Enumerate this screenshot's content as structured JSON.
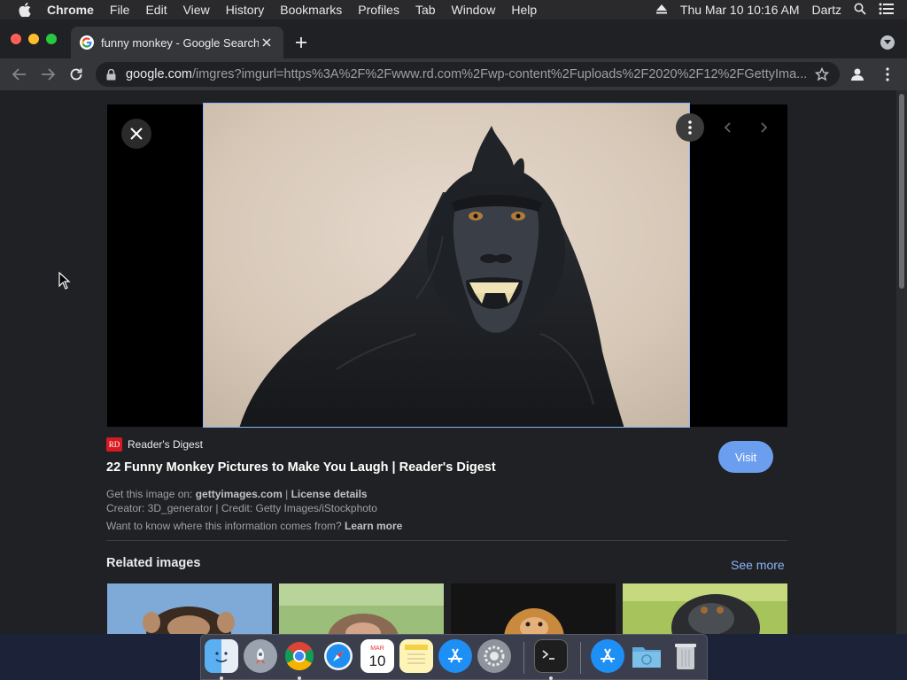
{
  "menubar": {
    "app": "Chrome",
    "items": [
      "File",
      "Edit",
      "View",
      "History",
      "Bookmarks",
      "Profiles",
      "Tab",
      "Window",
      "Help"
    ],
    "clock": "Thu Mar 10  10:16 AM",
    "user": "Dartz"
  },
  "browser": {
    "tab_title": "funny monkey - Google Search",
    "url_host": "google.com",
    "url_path": "/imgres?imgurl=https%3A%2F%2Fwww.rd.com%2Fwp-content%2Fuploads%2F2020%2F12%2FGettyIma..."
  },
  "result": {
    "source_logo": "RD",
    "source_name": "Reader's Digest",
    "title": "22 Funny Monkey Pictures to Make You Laugh | Reader's Digest",
    "visit_label": "Visit",
    "get_image_prefix": "Get this image on: ",
    "get_image_site": "gettyimages.com",
    "get_image_sep": " | ",
    "license_label": "License details",
    "creator_line": "Creator: 3D_generator | Credit: Getty Images/iStockphoto",
    "info_prefix": "Want to know where this information comes from? ",
    "learn_more": "Learn more"
  },
  "related": {
    "title": "Related images",
    "see_more": "See more",
    "thumbnails": [
      "chimpanzee",
      "macaque",
      "baby monkey",
      "crested macaque"
    ]
  },
  "dock": {
    "apps": [
      "Finder",
      "Launchpad",
      "Chrome",
      "Safari",
      "Calendar",
      "Notes",
      "App Store",
      "System Preferences",
      "Terminal",
      "Applications",
      "Downloads",
      "Trash"
    ],
    "calendar_month": "MAR",
    "calendar_day": "10"
  },
  "colors": {
    "accent": "#8ab4f8",
    "visit_button": "#6c9ef0",
    "reader_digest_red": "#d71920"
  }
}
